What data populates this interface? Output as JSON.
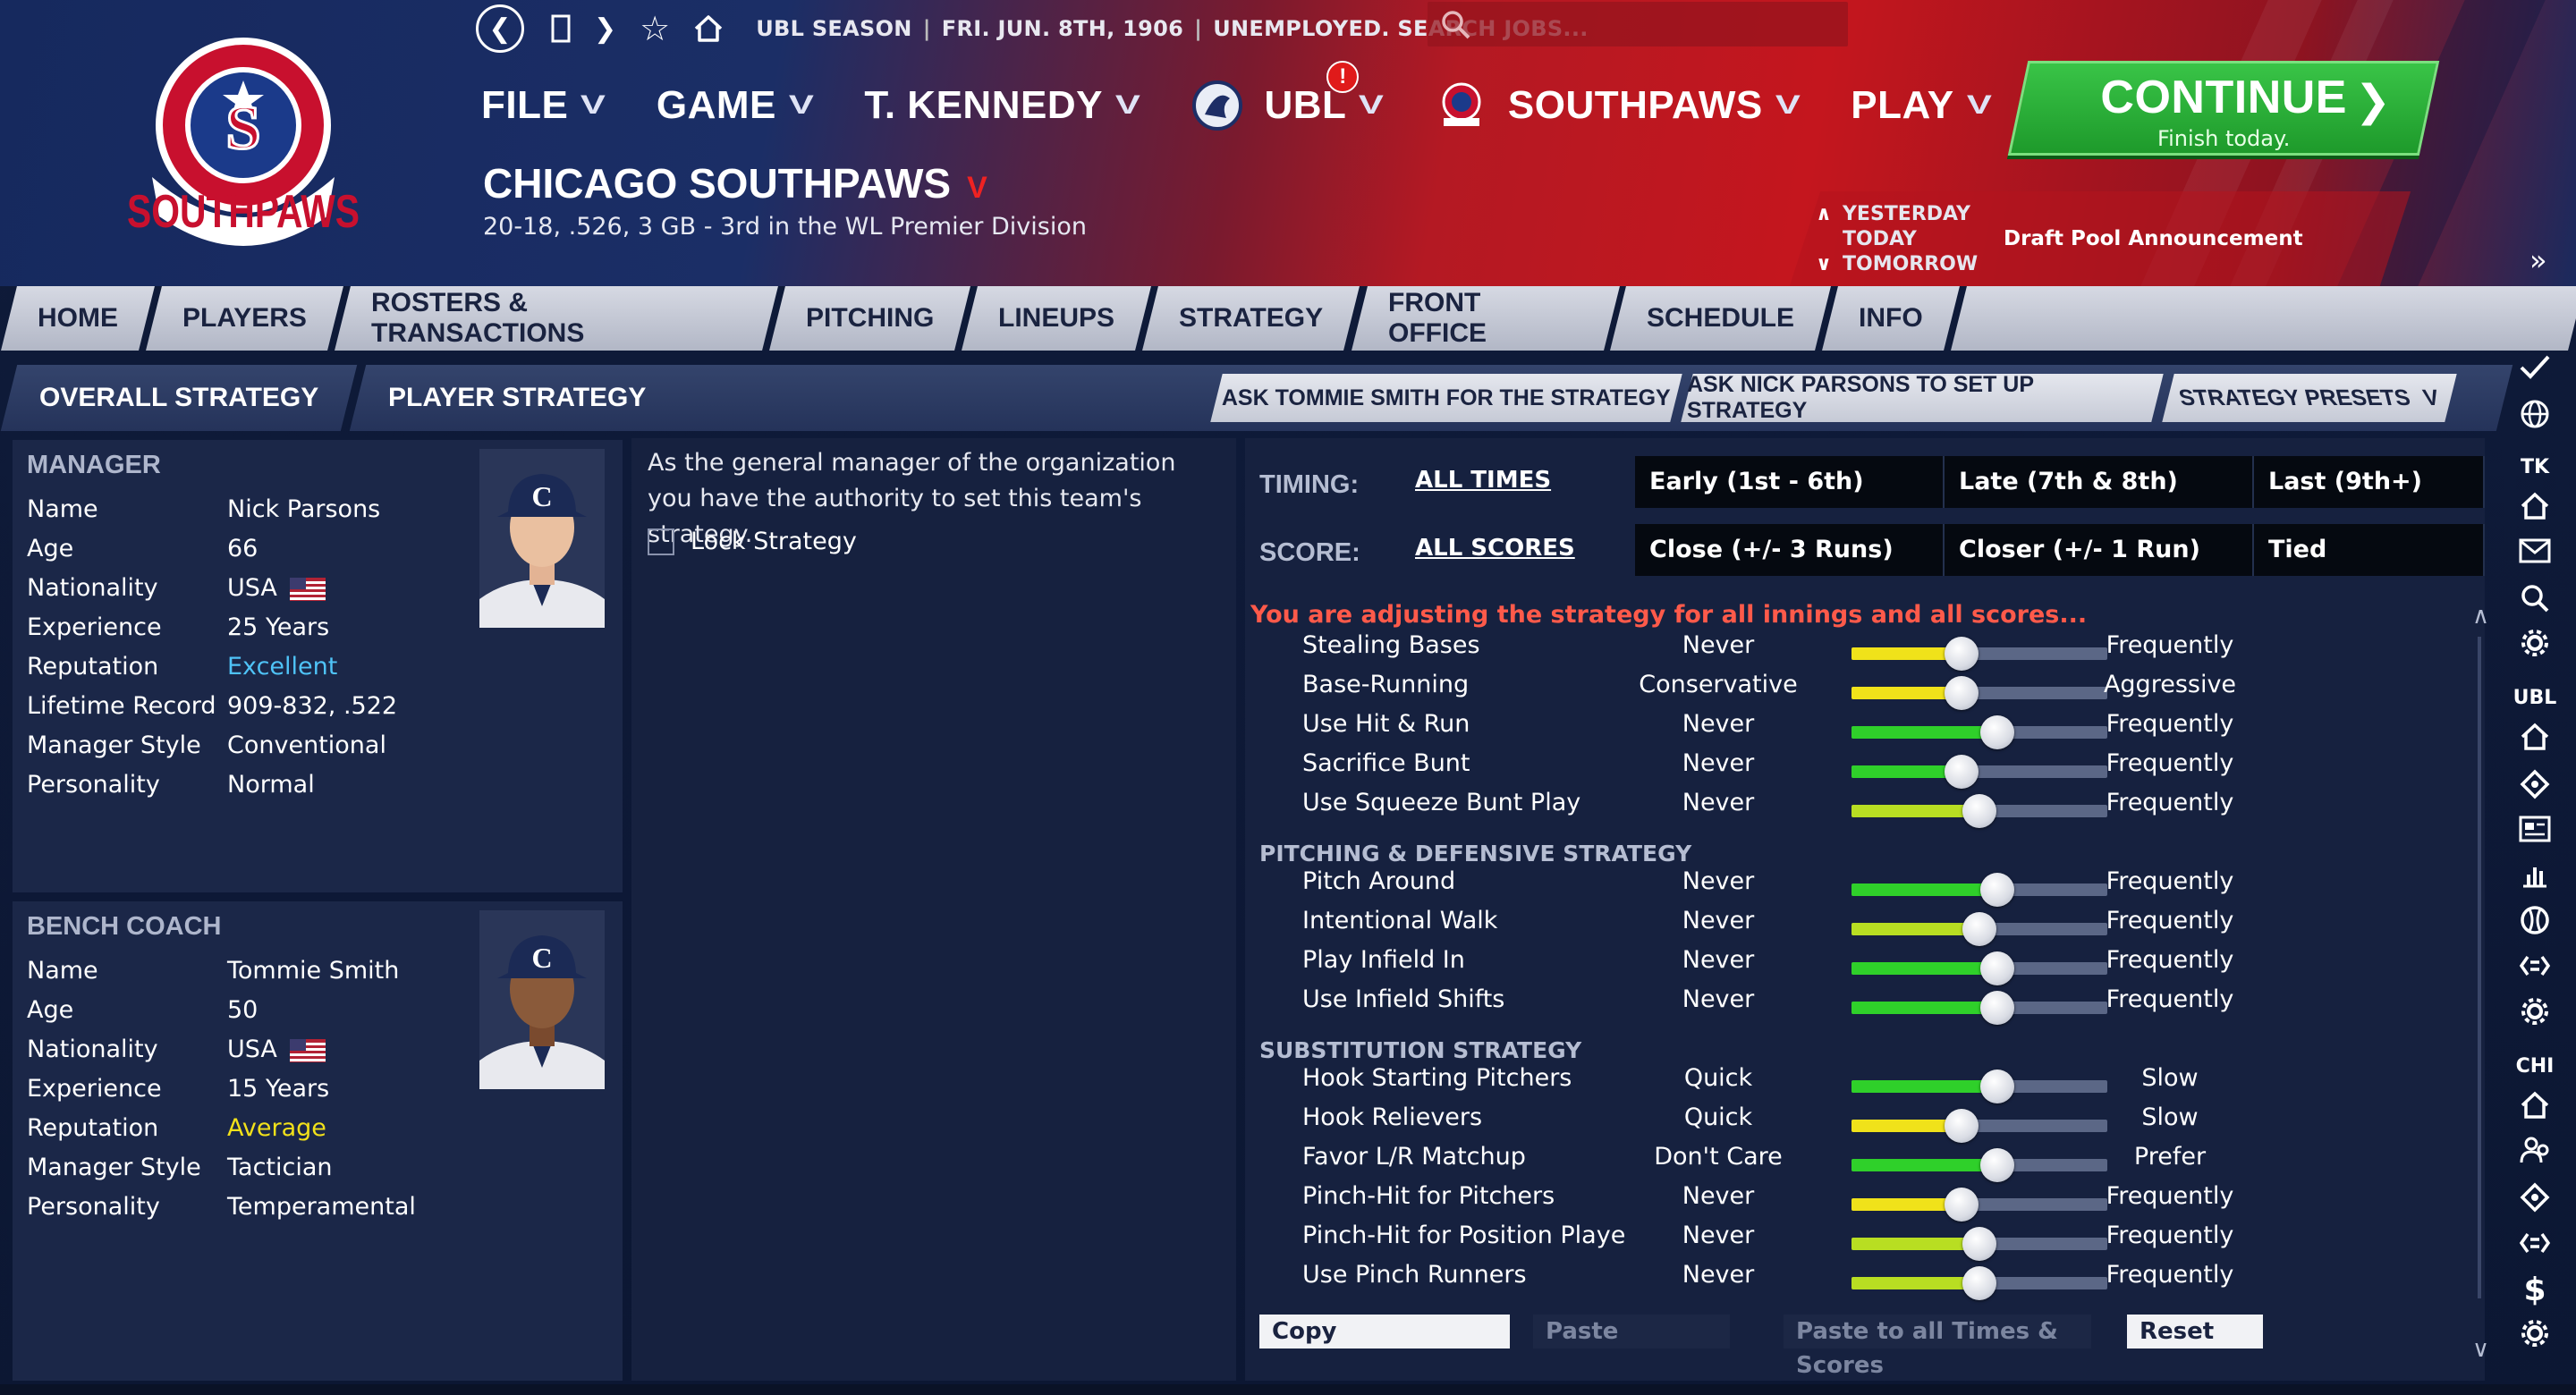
{
  "topbar": {
    "season": "UBL SEASON",
    "date": "FRI. JUN. 8TH, 1906",
    "status": "UNEMPLOYED. SEARCH JOBS...",
    "search_placeholder": ""
  },
  "logo": {
    "text_top": "CHICAGO",
    "text_bottom": "SOUTHPAWS"
  },
  "main_nav": {
    "file": "FILE",
    "game": "GAME",
    "user": "T. KENNEDY",
    "league": "UBL",
    "league_badge": "!",
    "team": "SOUTHPAWS",
    "play": "PLAY"
  },
  "continue": {
    "title": "CONTINUE",
    "subtitle": "Finish today."
  },
  "team_header": {
    "name": "CHICAGO SOUTHPAWS",
    "record": "20-18, .526, 3 GB - 3rd in the WL Premier Division"
  },
  "day_nav": {
    "yesterday": "YESTERDAY",
    "today": "TODAY",
    "tomorrow": "TOMORROW",
    "event": "Draft Pool Announcement"
  },
  "tabs": [
    "HOME",
    "PLAYERS",
    "ROSTERS & TRANSACTIONS",
    "PITCHING",
    "LINEUPS",
    "STRATEGY",
    "FRONT OFFICE",
    "SCHEDULE",
    "INFO"
  ],
  "subtabs": [
    "OVERALL STRATEGY",
    "PLAYER STRATEGY"
  ],
  "actions": {
    "ask_tommie": "ASK TOMMIE SMITH FOR THE STRATEGY",
    "ask_nick": "ASK NICK PARSONS TO SET UP STRATEGY",
    "presets": "STRATEGY PRESETS"
  },
  "manager": {
    "title": "MANAGER",
    "rows": [
      {
        "k": "Name",
        "v": "Nick Parsons"
      },
      {
        "k": "Age",
        "v": "66"
      },
      {
        "k": "Nationality",
        "v": "USA"
      },
      {
        "k": "Experience",
        "v": "25 Years"
      },
      {
        "k": "Reputation",
        "v": "Excellent"
      },
      {
        "k": "Lifetime Record",
        "v": "909-832, .522"
      },
      {
        "k": "Manager Style",
        "v": "Conventional"
      },
      {
        "k": "Personality",
        "v": "Normal"
      }
    ],
    "reputation_color": "#4fc3f7"
  },
  "bench_coach": {
    "title": "BENCH COACH",
    "rows": [
      {
        "k": "Name",
        "v": "Tommie Smith"
      },
      {
        "k": "Age",
        "v": "50"
      },
      {
        "k": "Nationality",
        "v": "USA"
      },
      {
        "k": "Experience",
        "v": "15 Years"
      },
      {
        "k": "Reputation",
        "v": "Average"
      },
      {
        "k": "Manager Style",
        "v": "Tactician"
      },
      {
        "k": "Personality",
        "v": "Temperamental"
      }
    ],
    "reputation_color": "#f2e11a"
  },
  "info_text": "As the general manager of the organization you have the authority to set this team's strategy.",
  "lock_label": "Lock Strategy",
  "timing": {
    "label": "TIMING:",
    "link": "ALL TIMES",
    "options": [
      "Early (1st - 6th)",
      "Late (7th & 8th)",
      "Last (9th+)"
    ]
  },
  "score": {
    "label": "SCORE:",
    "link": "ALL SCORES",
    "options": [
      "Close (+/- 3 Runs)",
      "Closer (+/- 1 Run)",
      "Tied"
    ]
  },
  "adjust_message": "You are adjusting the strategy for all innings and all scores...",
  "sections": {
    "pitching": "PITCHING & DEFENSIVE STRATEGY",
    "substitution": "SUBSTITUTION STRATEGY"
  },
  "sliders": [
    {
      "label": "Stealing Bases",
      "lo": "Never",
      "hi": "Frequently",
      "value": 0.43,
      "color": "yellow"
    },
    {
      "label": "Base-Running",
      "lo": "Conservative",
      "hi": "Aggressive",
      "value": 0.43,
      "color": "yellow"
    },
    {
      "label": "Use Hit & Run",
      "lo": "Never",
      "hi": "Frequently",
      "value": 0.57,
      "color": "green"
    },
    {
      "label": "Sacrifice Bunt",
      "lo": "Never",
      "hi": "Frequently",
      "value": 0.43,
      "color": "green"
    },
    {
      "label": "Use Squeeze Bunt Play",
      "lo": "Never",
      "hi": "Frequently",
      "value": 0.5,
      "color": "lime"
    },
    {
      "label": "Pitch Around",
      "lo": "Never",
      "hi": "Frequently",
      "value": 0.57,
      "color": "green"
    },
    {
      "label": "Intentional Walk",
      "lo": "Never",
      "hi": "Frequently",
      "value": 0.5,
      "color": "lime"
    },
    {
      "label": "Play Infield In",
      "lo": "Never",
      "hi": "Frequently",
      "value": 0.57,
      "color": "green"
    },
    {
      "label": "Use Infield Shifts",
      "lo": "Never",
      "hi": "Frequently",
      "value": 0.57,
      "color": "green"
    },
    {
      "label": "Hook Starting Pitchers",
      "lo": "Quick",
      "hi": "Slow",
      "value": 0.57,
      "color": "green"
    },
    {
      "label": "Hook Relievers",
      "lo": "Quick",
      "hi": "Slow",
      "value": 0.43,
      "color": "yellow"
    },
    {
      "label": "Favor L/R Matchup",
      "lo": "Don't Care",
      "hi": "Prefer",
      "value": 0.57,
      "color": "green"
    },
    {
      "label": "Pinch-Hit for Pitchers",
      "lo": "Never",
      "hi": "Frequently",
      "value": 0.43,
      "color": "yellow"
    },
    {
      "label": "Pinch-Hit for Position Playe",
      "lo": "Never",
      "hi": "Frequently",
      "value": 0.5,
      "color": "lime"
    },
    {
      "label": "Use Pinch Runners",
      "lo": "Never",
      "hi": "Frequently",
      "value": 0.5,
      "color": "lime"
    }
  ],
  "buttons": {
    "copy": "Copy",
    "paste": "Paste",
    "paste_all": "Paste to all Times & Scores",
    "reset": "Reset"
  },
  "sidebar": {
    "tk": "TK",
    "ubl": "UBL",
    "chi": "CHI"
  },
  "colors": {
    "green": "#2fd02a",
    "yellow": "#f0e21a",
    "lime": "#b8de22",
    "continue": "#2aa836",
    "accent_red": "#c4161e"
  }
}
